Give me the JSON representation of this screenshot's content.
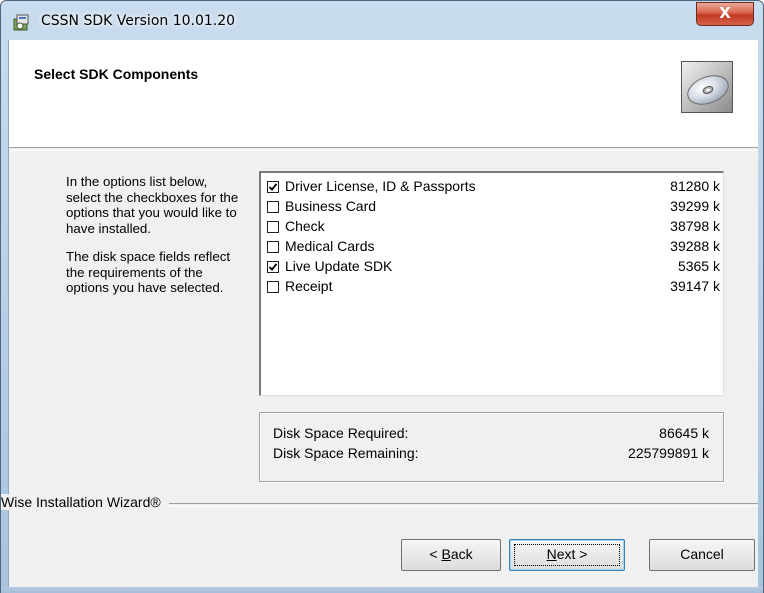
{
  "window": {
    "title": "CSSN SDK Version 10.01.20",
    "close_label": "X",
    "app_icon": "installer-icon"
  },
  "header": {
    "title": "Select SDK Components",
    "image": "cd-disc-icon"
  },
  "description": {
    "paragraph1": "In the options list below, select the checkboxes for the options that you would like to have installed.",
    "paragraph2": "The disk space fields reflect the requirements of the options you have selected."
  },
  "options": [
    {
      "label": "Driver License, ID & Passports",
      "size": "81280 k",
      "checked": true
    },
    {
      "label": "Business Card",
      "size": "39299 k",
      "checked": false
    },
    {
      "label": "Check",
      "size": "38798 k",
      "checked": false
    },
    {
      "label": "Medical Cards",
      "size": "39288 k",
      "checked": false
    },
    {
      "label": "Live Update SDK",
      "size": "5365 k",
      "checked": true
    },
    {
      "label": "Receipt",
      "size": "39147 k",
      "checked": false
    }
  ],
  "disk_space": {
    "required_label": "Disk Space Required:",
    "required_value": "86645 k",
    "remaining_label": "Disk Space Remaining:",
    "remaining_value": "225799891 k"
  },
  "footer": {
    "label": "Wise Installation Wizard®"
  },
  "buttons": {
    "back_pre": "< ",
    "back_key": "B",
    "back_rest": "ack",
    "next_key": "N",
    "next_rest": "ext >",
    "cancel": "Cancel"
  },
  "colors": {
    "title_bar": "#c9dcef",
    "close_button": "#c73c22",
    "dialog_bg": "#f0f0f0"
  }
}
